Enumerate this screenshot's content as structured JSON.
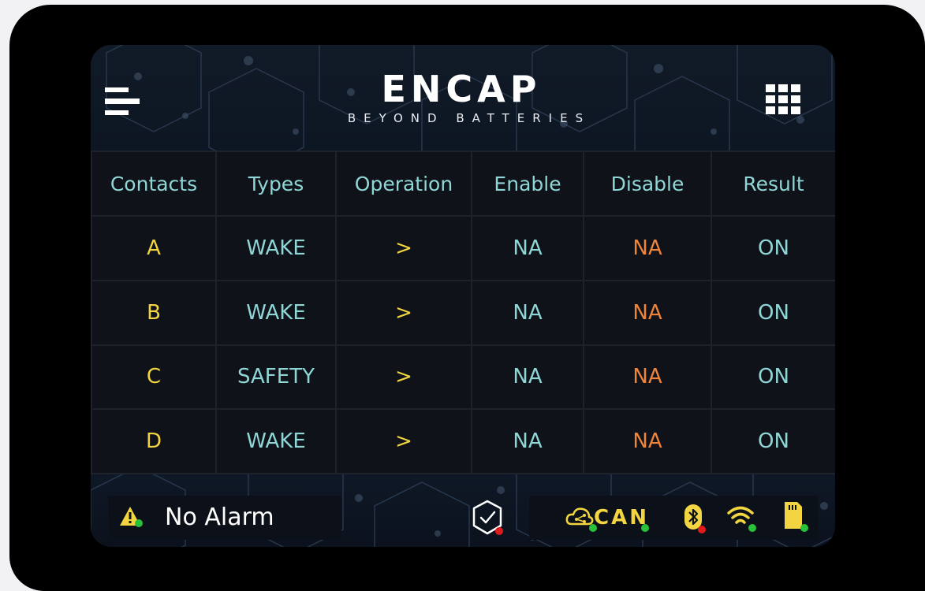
{
  "brand": {
    "name": "ENCAP",
    "tagline": "BEYOND BATTERIES"
  },
  "colors": {
    "accent_yellow": "#f2d540",
    "accent_teal": "#8fd6d6",
    "accent_orange": "#f0833a",
    "ok_green": "#28c23a",
    "error_red": "#e01b1b"
  },
  "header": {
    "menu_icon": "hamburger-menu-icon",
    "apps_icon": "grid-apps-icon"
  },
  "table": {
    "columns": [
      "Contacts",
      "Types",
      "Operation",
      "Enable",
      "Disable",
      "Result"
    ],
    "rows": [
      {
        "contact": "A",
        "type": "WAKE",
        "operation": ">",
        "enable": "NA",
        "disable": "NA",
        "result": "ON"
      },
      {
        "contact": "B",
        "type": "WAKE",
        "operation": ">",
        "enable": "NA",
        "disable": "NA",
        "result": "ON"
      },
      {
        "contact": "C",
        "type": "SAFETY",
        "operation": ">",
        "enable": "NA",
        "disable": "NA",
        "result": "ON"
      },
      {
        "contact": "D",
        "type": "WAKE",
        "operation": ">",
        "enable": "NA",
        "disable": "NA",
        "result": "ON"
      }
    ]
  },
  "footer": {
    "alarm_text": "No Alarm",
    "alarm_icon": "warning-triangle-icon",
    "shield_icon": "shield-check-icon",
    "can_label": "CAN",
    "status_icons": [
      "cloud-connection-icon",
      "can-bus-icon",
      "bluetooth-icon",
      "wifi-icon",
      "sd-card-icon"
    ]
  }
}
